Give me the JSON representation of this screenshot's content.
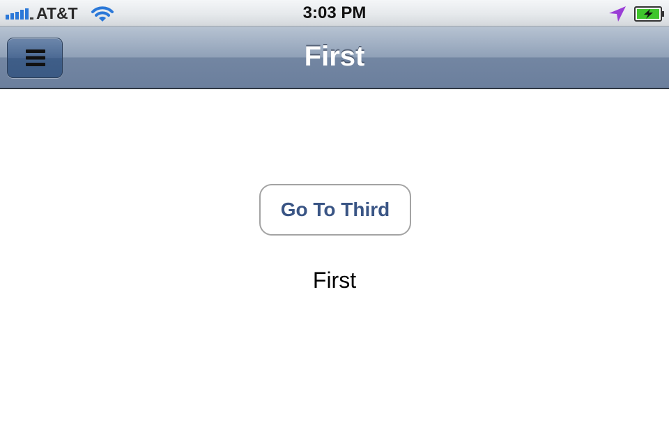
{
  "status_bar": {
    "carrier": "AT&T",
    "time": "3:03 PM",
    "icons": {
      "signal": "signal-bars-icon",
      "wifi": "wifi-icon",
      "location": "location-arrow-icon",
      "battery": "battery-charging-icon"
    },
    "colors": {
      "signal": "#2b78d8",
      "wifi": "#2b78d8",
      "location": "#9a3ed6",
      "battery_fill": "#3fc52c"
    }
  },
  "nav_bar": {
    "title": "First",
    "menu_button_icon": "menu-hamburger-icon"
  },
  "content": {
    "goto_button_label": "Go To Third",
    "label": "First"
  },
  "colors": {
    "nav_bar": "#7386a2",
    "menu_button": "#4c6a94",
    "button_text": "#3a5585"
  }
}
